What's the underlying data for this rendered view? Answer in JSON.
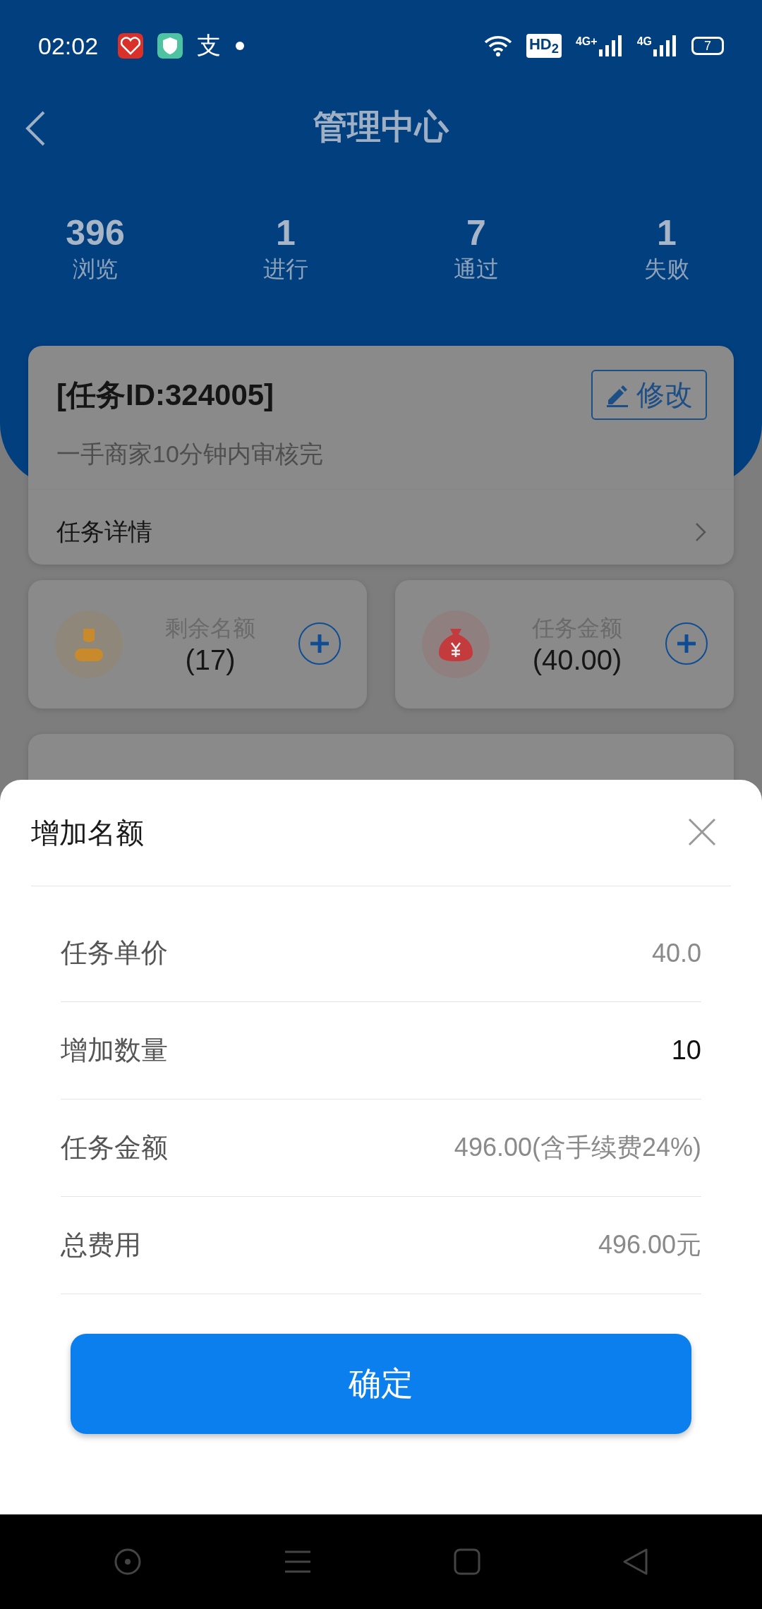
{
  "status_bar": {
    "time": "02:02",
    "app_glyph": "支",
    "hd_badge": "HD$_{2}$",
    "signals": [
      {
        "label": "4G+"
      },
      {
        "label": "4G"
      }
    ],
    "battery": "7"
  },
  "header": {
    "title": "管理中心"
  },
  "stats": [
    {
      "value": "396",
      "label": "浏览"
    },
    {
      "value": "1",
      "label": "进行"
    },
    {
      "value": "7",
      "label": "通过"
    },
    {
      "value": "1",
      "label": "失败"
    }
  ],
  "task_card": {
    "title": "[任务ID:324005]",
    "edit_button": "修改",
    "subtitle": "一手商家10分钟内审核完",
    "detail_link": "任务详情"
  },
  "quota_cards": [
    {
      "kind": "person",
      "label": "剩余名额",
      "value": "(17)"
    },
    {
      "kind": "money",
      "label": "任务金额",
      "value": "(40.00)"
    }
  ],
  "sheet": {
    "title": "增加名额",
    "rows": [
      {
        "kind": "text",
        "label": "任务单价",
        "value": "40.0"
      },
      {
        "kind": "input",
        "label": "增加数量",
        "value": "10"
      },
      {
        "kind": "text",
        "label": "任务金额",
        "value": "496.00(含手续费24%)"
      },
      {
        "kind": "text",
        "label": "总费用",
        "value": "496.00元"
      }
    ],
    "confirm_button": "确定"
  }
}
